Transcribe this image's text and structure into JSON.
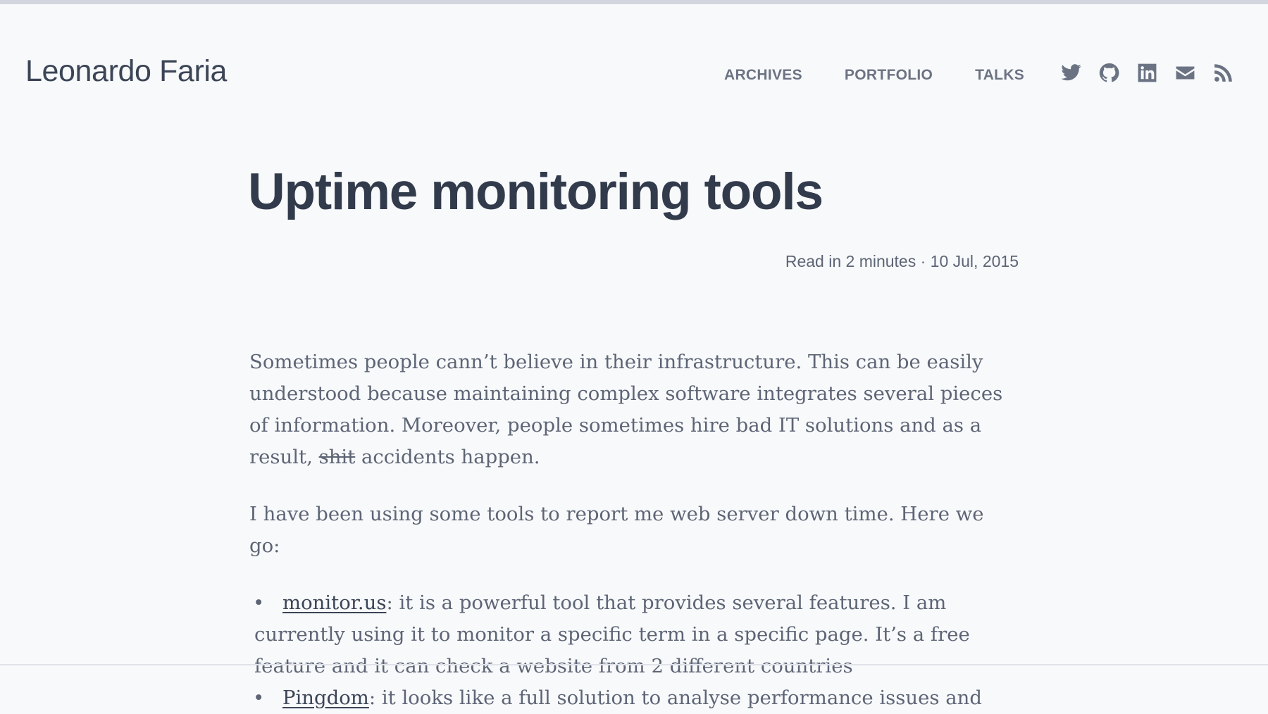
{
  "site": {
    "title": "Leonardo Faria"
  },
  "nav": {
    "items": [
      {
        "label": "ARCHIVES"
      },
      {
        "label": "PORTFOLIO"
      },
      {
        "label": "TALKS"
      }
    ]
  },
  "social": {
    "icons": [
      "twitter-icon",
      "github-icon",
      "linkedin-icon",
      "email-icon",
      "rss-icon"
    ]
  },
  "post": {
    "title": "Uptime monitoring tools",
    "meta": "Read in 2 minutes · 10 Jul, 2015",
    "p1_strike": "shit",
    "p1_before": "Sometimes people cann’t believe in their infrastructure. This can be easily understood because maintaining complex software integrates several pieces of information. Moreover, people sometimes hire bad IT solutions and as a result,",
    "p1_after": " accidents happen.",
    "p2": "I have been using some tools to report me web server down time. Here we go:",
    "list": [
      {
        "bullet": "•",
        "link": "monitor.us",
        "text": ": it is a powerful tool that provides several features. I am currently using it to monitor a specific term in a specific page. It’s a free feature and it can check a website from 2 different countries"
      },
      {
        "bullet": "•",
        "link": "Pingdom",
        "text": ": it looks like a full solution to analyse performance issues and"
      }
    ]
  },
  "colors": {
    "background": "#f8f9fb",
    "heading": "#323b4c",
    "body_text": "#5d6575",
    "nav": "#6b7383",
    "top_bar": "#d3d6de"
  }
}
